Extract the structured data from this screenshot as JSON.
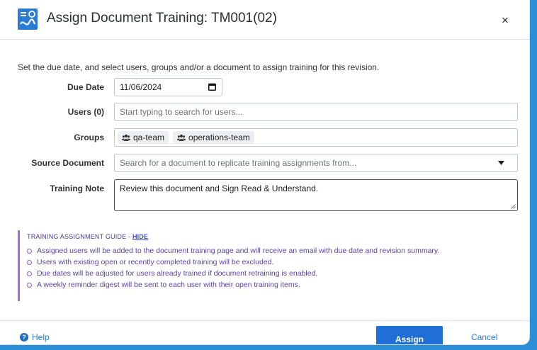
{
  "dialog": {
    "title": "Assign Document Training: TM001(02)",
    "close_glyph": "×",
    "intro": "Set the due date, and select users, groups and/or a document to assign training for this revision."
  },
  "form": {
    "due_date": {
      "label": "Due Date",
      "value": "11/06/2024"
    },
    "users": {
      "label": "Users (0)",
      "placeholder": "Start typing to search for users..."
    },
    "groups": {
      "label": "Groups",
      "chips": [
        "qa-team",
        "operations-team"
      ]
    },
    "source_document": {
      "label": "Source Document",
      "placeholder": "Search for a document to replicate training assignments from..."
    },
    "training_note": {
      "label": "Training Note",
      "value": "Review this document and Sign Read & Understand."
    }
  },
  "guide": {
    "title": "TRAINING ASSIGNMENT GUIDE - ",
    "hide_link": "HIDE",
    "items": [
      "Assigned users will be added to the document training page and will receive an email with due date and revision summary.",
      "Users with existing open or recently completed training will be excluded.",
      "Due dates will be adjusted for users already trained if document retraining is enabled.",
      "A weekly reminder digest will be sent to each user with their open training items."
    ]
  },
  "footer": {
    "help_label": "Help",
    "assign_label": "Assign",
    "cancel_label": "Cancel"
  },
  "colors": {
    "accent": "#1f6fd6",
    "frame": "#2a8fd6",
    "guide_text": "#5a44a8",
    "guide_border": "#9b73d8"
  },
  "icons": {
    "app": "document-training-logo-icon",
    "close": "close-icon",
    "calendar": "calendar-icon",
    "group": "group-icon",
    "dropdown": "caret-down-icon",
    "help": "help-icon"
  }
}
